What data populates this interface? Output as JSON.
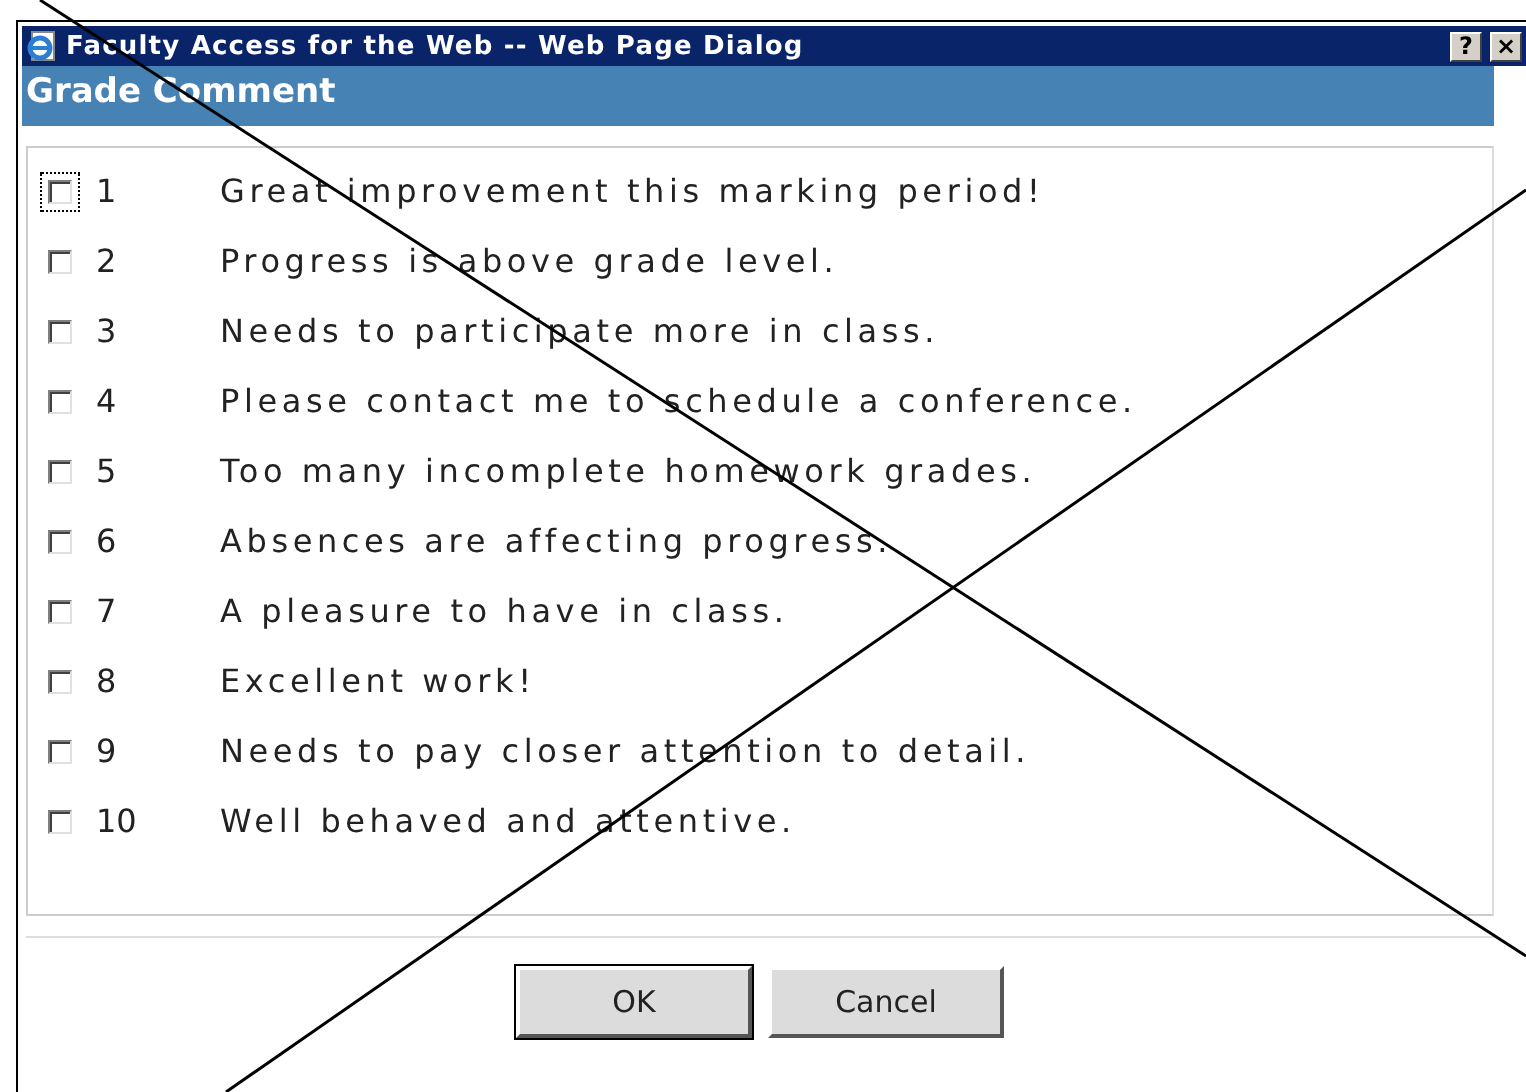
{
  "window": {
    "title": "Faculty Access for the Web -- Web Page Dialog",
    "help_button": "?",
    "close_button": "×"
  },
  "header": "Grade Comment",
  "comments": [
    {
      "number": "1",
      "text": "Great improvement this marking period!",
      "checked": false,
      "focused": true
    },
    {
      "number": "2",
      "text": "Progress is above grade level.",
      "checked": false,
      "focused": false
    },
    {
      "number": "3",
      "text": "Needs to participate more in class.",
      "checked": false,
      "focused": false
    },
    {
      "number": "4",
      "text": "Please contact me to schedule a conference.",
      "checked": false,
      "focused": false
    },
    {
      "number": "5",
      "text": "Too many incomplete homework grades.",
      "checked": false,
      "focused": false
    },
    {
      "number": "6",
      "text": "Absences are affecting progress.",
      "checked": false,
      "focused": false
    },
    {
      "number": "7",
      "text": "A pleasure to have in class.",
      "checked": false,
      "focused": false
    },
    {
      "number": "8",
      "text": "Excellent work!",
      "checked": false,
      "focused": false
    },
    {
      "number": "9",
      "text": "Needs to pay closer attention to detail.",
      "checked": false,
      "focused": false
    },
    {
      "number": "10",
      "text": "Well behaved and attentive.",
      "checked": false,
      "focused": false
    }
  ],
  "buttons": [
    {
      "label": "OK",
      "default": true
    },
    {
      "label": "Cancel",
      "default": false
    }
  ]
}
